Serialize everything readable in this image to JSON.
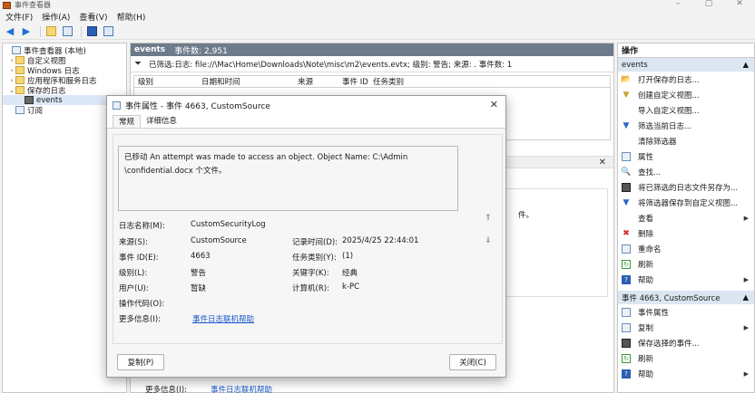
{
  "window": {
    "title": "事件查看器",
    "controls": [
      "–",
      "▢",
      "✕"
    ]
  },
  "menu": [
    "文件(F)",
    "操作(A)",
    "查看(V)",
    "帮助(H)"
  ],
  "tree": {
    "items": [
      {
        "label": "事件查看器 (本地)",
        "icon": "log-icon",
        "level": 0,
        "arrow": ""
      },
      {
        "label": "自定义视图",
        "icon": "folder-icon",
        "level": 1,
        "arrow": "›"
      },
      {
        "label": "Windows 日志",
        "icon": "folder-icon",
        "level": 1,
        "arrow": "›"
      },
      {
        "label": "应用程序和服务日志",
        "icon": "folder-icon",
        "level": 1,
        "arrow": "›"
      },
      {
        "label": "保存的日志",
        "icon": "folder-icon",
        "level": 1,
        "arrow": "⌄"
      },
      {
        "label": "events",
        "icon": "disk-icon",
        "level": 2,
        "arrow": ""
      },
      {
        "label": "订阅",
        "icon": "subscription-icon",
        "level": 1,
        "arrow": ""
      }
    ]
  },
  "middle": {
    "header_name": "events",
    "header_count": "事件数: 2,951",
    "filter_text": "已筛选:日志: file://\\Mac\\Home\\Downloads\\Note\\misc\\m2\\events.evtx; 级别: 警告; 来源: . 事件数: 1",
    "columns": [
      "级别",
      "日期和时间",
      "来源",
      "事件 ID",
      "任务类别"
    ],
    "detail_fragment": "件。",
    "bottom_more_label": "更多信息(I):",
    "bottom_more_link": "事件日志联机帮助"
  },
  "actions": {
    "title": "操作",
    "section1": "events",
    "items1": [
      {
        "label": "打开保存的日志...",
        "icon": "open-icon"
      },
      {
        "label": "创建自定义视图...",
        "icon": "filter-create-icon"
      },
      {
        "label": "导入自定义视图...",
        "icon": ""
      },
      {
        "label": "筛选当前日志...",
        "icon": "filter-icon"
      },
      {
        "label": "清除筛选器",
        "icon": ""
      },
      {
        "label": "属性",
        "icon": "properties-icon"
      },
      {
        "label": "查找...",
        "icon": "find-icon"
      },
      {
        "label": "将已筛选的日志文件另存为...",
        "icon": "save-icon"
      },
      {
        "label": "将筛选器保存到自定义视图...",
        "icon": "filter-save-icon"
      },
      {
        "label": "查看",
        "icon": "",
        "sub": true
      },
      {
        "label": "删除",
        "icon": "delete-icon"
      },
      {
        "label": "重命名",
        "icon": "rename-icon"
      },
      {
        "label": "刷新",
        "icon": "refresh-icon"
      },
      {
        "label": "帮助",
        "icon": "help-icon",
        "sub": true
      }
    ],
    "section2": "事件 4663, CustomSource",
    "items2": [
      {
        "label": "事件属性",
        "icon": "properties-icon"
      },
      {
        "label": "复制",
        "icon": "copy-icon",
        "sub": true
      },
      {
        "label": "保存选择的事件...",
        "icon": "save-icon"
      },
      {
        "label": "刷新",
        "icon": "refresh-icon"
      },
      {
        "label": "帮助",
        "icon": "help-icon",
        "sub": true
      }
    ]
  },
  "dialog": {
    "title": "事件属性 - 事件 4663, CustomSource",
    "tab_general": "常规",
    "tab_details": "详细信息",
    "description_line1": "已移动 An attempt was made to access an object. Object Name: C:\\Admin",
    "description_line2": "\\confidential.docx 个文件。",
    "labels": {
      "log_name": "日志名称(M):",
      "source": "来源(S):",
      "event_id": "事件 ID(E):",
      "level": "级别(L):",
      "user": "用户(U):",
      "opcode": "操作代码(O):",
      "more_info": "更多信息(I):",
      "logged": "记录时间(D):",
      "task_category": "任务类别(Y):",
      "keywords": "关键字(K):",
      "computer": "计算机(R):"
    },
    "values": {
      "log_name": "CustomSecurityLog",
      "source": "CustomSource",
      "event_id": "4663",
      "level": "警告",
      "user": "暂缺",
      "opcode": "",
      "more_info_link": "事件日志联机帮助",
      "logged": "2025/4/25 22:44:01",
      "task_category": "(1)",
      "keywords": "经典",
      "computer": "k-PC"
    },
    "copy_button": "复制(P)",
    "close_button": "关闭(C)"
  }
}
